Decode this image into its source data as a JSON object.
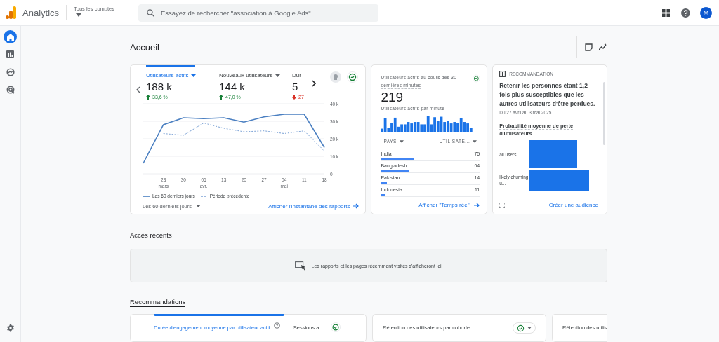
{
  "header": {
    "product": "Analytics",
    "account": "Tous les comptes",
    "search_placeholder": "Essayez de rechercher \"association à Google Ads\"",
    "avatar": "M"
  },
  "nav": [
    {
      "selected": true
    },
    {
      "selected": false
    },
    {
      "selected": false
    },
    {
      "selected": false
    }
  ],
  "page_title": "Accueil",
  "overview": {
    "metrics": [
      {
        "label": "Utilisateurs actifs",
        "value": "188 k",
        "kind": "increase",
        "change": "33,6 %",
        "color": "#188038",
        "selected": true,
        "dropdown": true
      },
      {
        "label": "Nouveaux utilisateurs",
        "value": "144 k",
        "kind": "increase",
        "change": "47,0 %",
        "color": "#188038",
        "selected": false,
        "dropdown": true
      },
      {
        "label": "Dur",
        "value": "5",
        "kind": "decrease",
        "change": "27",
        "color": "#d93025",
        "selected": false,
        "dropdown": false
      }
    ],
    "chart_data": {
      "type": "line",
      "grid": true,
      "legend": true,
      "categories": [
        null,
        "23 mars",
        "30",
        "06 avr.",
        "13",
        "20",
        "27",
        "04 mai",
        "11",
        "18"
      ],
      "ylim": [
        0,
        40000
      ],
      "yticks": [
        {
          "value": 0,
          "label": "0"
        },
        {
          "value": 10000,
          "label": "10 k"
        },
        {
          "value": 20000,
          "label": "20 k"
        },
        {
          "value": 30000,
          "label": "30 k"
        },
        {
          "value": 40000,
          "label": "40 k"
        }
      ],
      "series": [
        {
          "name": "Les 60 derniers jours",
          "color": "#4a7fc1",
          "line_style": "solid",
          "values": [
            6000,
            28000,
            32000,
            31500,
            32000,
            29500,
            32500,
            34000,
            34000,
            15000
          ]
        },
        {
          "name": "Période précédente",
          "color": "#7da3d6",
          "line_style": "dashed",
          "values": [
            null,
            23000,
            22000,
            29000,
            26000,
            24000,
            24500,
            23000,
            24500,
            13000
          ]
        }
      ]
    },
    "range": "Les 60 derniers jours",
    "link": "Afficher l'instantané des rapports"
  },
  "realtime": {
    "title": "Utilisateurs actifs au cours des 30 dernières minutes",
    "value": "219",
    "subtitle": "Utilisateurs actifs par minute",
    "col_1": "PAYS",
    "col_2": "UTILISATE...",
    "rows": [
      {
        "name": "India",
        "value": "75",
        "level": 0.34
      },
      {
        "name": "Bangladesh",
        "value": "64",
        "level": 0.29
      },
      {
        "name": "Pakistan",
        "value": "14",
        "level": 0.06
      },
      {
        "name": "Indonesia",
        "value": "11",
        "level": 0.05
      }
    ],
    "link": "Afficher \"Temps réel\""
  },
  "recommendation": {
    "tag": "RECOMMANDATION",
    "text": "Retenir les personnes étant 1,2 fois plus susceptibles que les autres utilisateurs d'être perdues.",
    "dates": "Du 27 avril au 3 mai 2025",
    "metric": "Probabilité moyenne de perte d'utilisateurs",
    "bars": [
      "all users",
      "likely churning u..."
    ],
    "link": "Créer une audience"
  },
  "recent": {
    "title": "Accès récents",
    "empty": "Les rapports et les pages récemment visités s'afficheront ici."
  },
  "suggestions": {
    "title": "Recommandations",
    "cards": [
      {
        "kind": "metrics",
        "label": "Durée d'engagement moyenne par utilisateur actif",
        "other": "Sessions a"
      },
      {
        "kind": "report",
        "label": "Rétention des utilisateurs par cohorte"
      },
      {
        "kind": "report_cut",
        "label": "Rétention des utilis"
      }
    ]
  }
}
